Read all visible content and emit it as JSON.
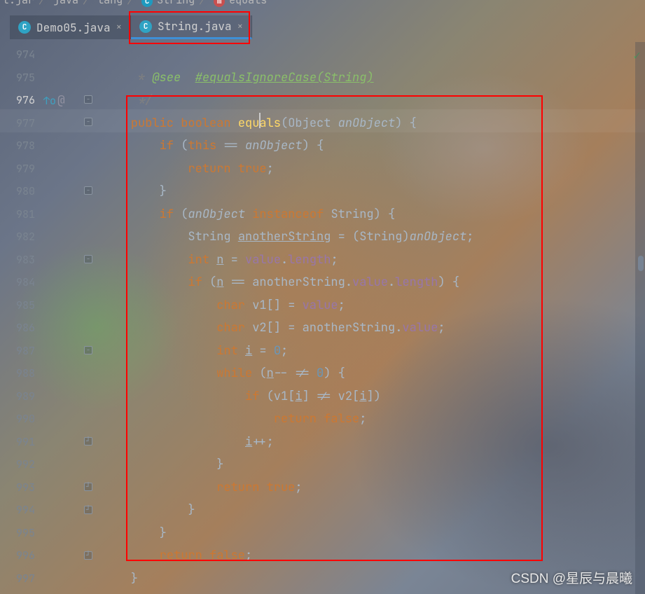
{
  "breadcrumbs": {
    "b0": "t.jar",
    "b1": "java",
    "b2": "lang",
    "b3": "String",
    "b4": "equals"
  },
  "tabs": {
    "t0": {
      "icon": "C",
      "label": "Demo05.java"
    },
    "t1": {
      "icon": "C",
      "label": "String.java"
    }
  },
  "close_glyph": "×",
  "gutter": {
    "override_tip": "↑o",
    "at": "@"
  },
  "lines": {
    "l0": "974",
    "l1": "975",
    "l2": "976",
    "l3": "977",
    "l4": "978",
    "l5": "979",
    "l6": "980",
    "l7": "981",
    "l8": "982",
    "l9": "983",
    "l10": "984",
    "l11": "985",
    "l12": "986",
    "l13": "987",
    "l14": "988",
    "l15": "989",
    "l16": "990",
    "l17": "991",
    "l18": "992",
    "l19": "993",
    "l20": "994",
    "l21": "995",
    "l22": "996",
    "l23": "997"
  },
  "code": {
    "c0a": "     * ",
    "c0_tag": "@see",
    "c0b": "  ",
    "c0_link": "#equalsIgnoreCase(String)",
    "c1": "     */",
    "c2_kw1": "    public ",
    "c2_kw2": "boolean ",
    "c2_m": "equals",
    "c2_p": "(Object ",
    "c2_pn": "anObject",
    "c2_e": ") {",
    "c3_a": "        ",
    "c3_if": "if ",
    "c3_b": "(",
    "c3_this": "this ",
    "c3_op": "== ",
    "c3_pn": "anObject",
    "c3_e": ") {",
    "c4_a": "            ",
    "c4_ret": "return true",
    "c4_sc": ";",
    "c5": "        }",
    "c6_a": "        ",
    "c6_if": "if ",
    "c6_b": "(",
    "c6_pn": "anObject ",
    "c6_io": "instanceof ",
    "c6_t": "String",
    "c6_e": ") {",
    "c7_a": "            ",
    "c7_t": "String ",
    "c7_v": "anotherString",
    "c7_eq": " = (",
    "c7_t2": "String",
    "c7_c": ")",
    "c7_pn": "anObject",
    "c7_sc": ";",
    "c8_a": "            ",
    "c8_t": "int ",
    "c8_v": "n",
    "c8_eq": " = ",
    "c8_f": "value",
    ".": ".",
    "c8_f2": "length",
    "c8_sc": ";",
    "c9_a": "            ",
    "c9_if": "if ",
    "c9_b": "(",
    "c9_v": "n",
    "c9_eq": " == ",
    "c9_v2": "anotherString",
    "c9_f": "value",
    ".2": ".",
    "c9_f2": "length",
    "c9_e": ") {",
    "c10_a": "                ",
    "c10_t": "char ",
    "c10_v": "v1[] = ",
    "c10_f": "value",
    "c10_sc": ";",
    "c11_a": "                ",
    "c11_t": "char ",
    "c11_v": "v2[] = ",
    "c11_v2": "anotherString",
    "c11_f": "value",
    "c11_sc": ";",
    "c12_a": "                ",
    "c12_t": "int ",
    "c12_v": "i",
    "c12_eq": " = ",
    "c12_n": "0",
    "c12_sc": ";",
    "c13_a": "                ",
    "c13_w": "while ",
    "c13_b": "(",
    "c13_v": "n",
    "c13_op": "-- != ",
    "c13_n": "0",
    "c13_e": ") {",
    "c14_a": "                    ",
    "c14_if": "if ",
    "c14_b": "(v1[",
    "c14_v": "i",
    "c14_m": "] != v2[",
    "c14_v2": "i",
    "c14_e": "])",
    "c15_a": "                        ",
    "c15_ret": "return false",
    "c15_sc": ";",
    "c16_a": "                    ",
    "c16_v": "i",
    "c16_op": "++;",
    "c17": "                }",
    "c18_a": "                ",
    "c18_ret": "return true",
    "c18_sc": ";",
    "c19": "            }",
    "c20": "        }",
    "c21_a": "        ",
    "c21_ret": "return false",
    "c21_sc": ";",
    "c22": "    }"
  },
  "watermark": "CSDN @星辰与晨曦",
  "ok": "✓"
}
